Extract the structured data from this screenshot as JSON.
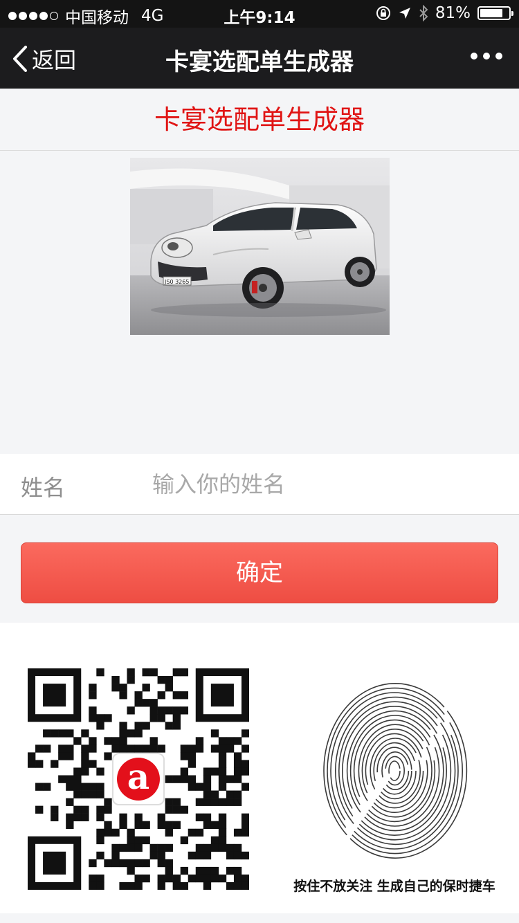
{
  "status_bar": {
    "carrier": "中国移动",
    "network": "4G",
    "time": "上午9:14",
    "battery": "81%",
    "battery_level": 0.81,
    "signal_bars": 4
  },
  "nav": {
    "back_label": "返回",
    "title": "卡宴选配单生成器"
  },
  "header": {
    "title": "卡宴选配单生成器",
    "title_color": "#e01414"
  },
  "car_image": {
    "plate": "JS0 3265"
  },
  "form": {
    "name_label": "姓名",
    "name_placeholder": "输入你的姓名",
    "name_value": ""
  },
  "confirm_button": {
    "label": "确定",
    "color": "#f25a4f"
  },
  "qr_code": {
    "logo_letter": "a"
  },
  "fingerprint": {
    "caption": "按住不放关注 生成自己的保时捷车"
  }
}
